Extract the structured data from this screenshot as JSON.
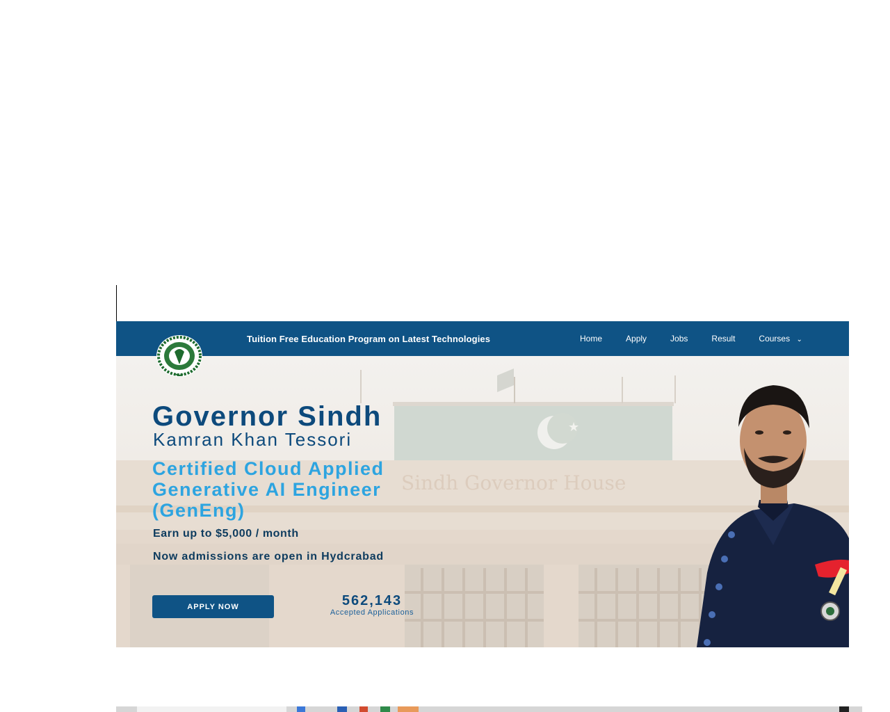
{
  "navbar": {
    "title": "Tuition Free Education Program on Latest Technologies",
    "links": [
      "Home",
      "Apply",
      "Jobs",
      "Result",
      "Courses"
    ],
    "courses_chevron": "⌄"
  },
  "hero": {
    "background_sign": "Sindh Governor House",
    "title": "Governor Sindh",
    "name": "Kamran Khan Tessori",
    "course": "Certified Cloud Applied Generative AI Engineer (GenEng)",
    "earn": "Earn up to $5,000 / month",
    "admissions": "Now admissions are open in Hydcrabad",
    "apply_button": "APPLY NOW",
    "count_value": "562,143",
    "count_label": "Accepted Applications"
  },
  "colors": {
    "navbar": "#0f5385",
    "title": "#0d4a7c",
    "accent": "#2da4e0",
    "text_dark": "#0d3b5e"
  },
  "icons": [
    "emblem-logo-icon",
    "chevron-down-icon",
    "portrait-image",
    "pakistan-flag-icon"
  ]
}
